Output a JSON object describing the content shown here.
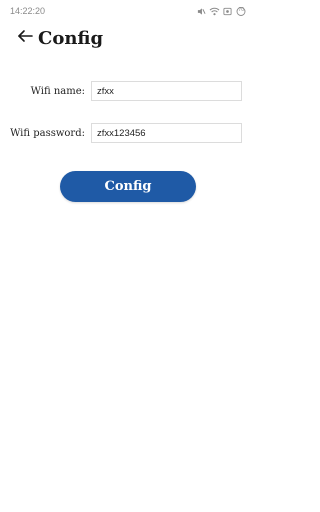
{
  "status_bar": {
    "time": "14:22:20",
    "battery_level": "70"
  },
  "app_bar": {
    "title": "Config"
  },
  "form": {
    "wifi_name_label": "Wifi name:",
    "wifi_name_value": "zfxx",
    "wifi_password_label": "Wifi password:",
    "wifi_password_value": "zfxx123456"
  },
  "actions": {
    "config_label": "Config"
  },
  "colors": {
    "accent": "#1f5aa6",
    "status_text": "#8a8a8a"
  },
  "icons": {
    "back": "arrow-left-icon",
    "mute": "mute-icon",
    "wifi": "wifi-icon",
    "screenshot": "screenshot-icon",
    "battery": "battery-icon"
  }
}
